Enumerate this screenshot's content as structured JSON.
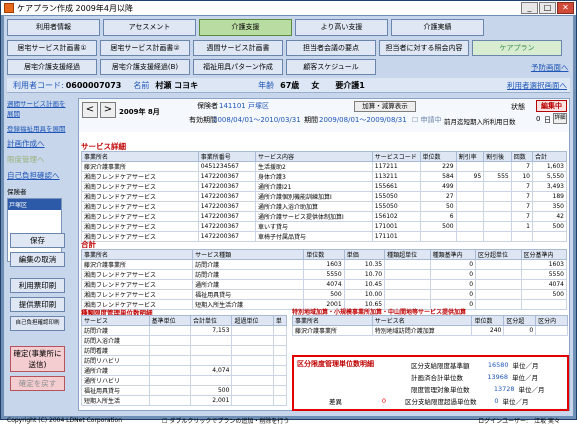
{
  "window": {
    "title": "ケアプラン作成 2009年4月以降",
    "minimize": "_",
    "maximize": "□",
    "close": "✕"
  },
  "tabs_row1": [
    "利用者情報",
    "アセスメント",
    "介護支援",
    "より高い支援",
    "介護実績"
  ],
  "tabs_row2": [
    "居宅サービス計画書①",
    "居宅サービス計画書②",
    "週間サービス計画書",
    "担当者会議の要点",
    "担当者に対する照会内容",
    "ケアプラン"
  ],
  "tabs_row3": [
    "居宅介護支援経過",
    "居宅介護支援経過(B)",
    "福祉用具パターン作成",
    "顧客スケジュール"
  ],
  "links": {
    "yobo": "予防画面へ",
    "user_select": "利用者選択画面へ"
  },
  "info": {
    "user_code_label": "利用者コード:",
    "user_code": "0600007073",
    "name_label": "名前",
    "name": "村瀬 コヨキ",
    "age_label": "年齢",
    "age": "67歳",
    "sex": "女",
    "care_level": "要介護1"
  },
  "left_nav": {
    "link1": "週間サービス計画を展開",
    "link2": "登録福祉用具を展開",
    "link3": "計画作成へ",
    "link4": "限度管理へ",
    "link5": "自己負担確認へ",
    "insurer_label": "保険者",
    "insurer_selected": "戸塚区",
    "buttons": [
      "保存",
      "編集の取消",
      "利用票印刷",
      "提供票印刷",
      "自己負担確認印刷"
    ],
    "confirm_button": "確定(事業所に送信)",
    "revert_button": "確定を戻す"
  },
  "plan": {
    "prev_arrow": "<",
    "next_arrow": ">",
    "year_month": "2009年 8月",
    "insurer_no_label": "保険者",
    "insurer_no": "141101 戸塚区",
    "valid_label": "有効期間",
    "valid": "2008/04/01〜2010/03/31",
    "period_label": "期間",
    "period": "2009/08/01〜2009/08/31",
    "add_btn": "加算・減算表示",
    "apply_label": "申請中",
    "prev_label": "前月迄短期入所利用日数",
    "prev_days": "0",
    "prev_unit": "日",
    "detail_btn": "詳細",
    "status_label": "状態",
    "status_btn": "編集中"
  },
  "service_detail": {
    "title": "サービス詳細",
    "headers": [
      "事業所名",
      "事業所番号",
      "サービス内容",
      "サービスコード",
      "単位数",
      "割引率",
      "割引後",
      "回数",
      "合計"
    ],
    "rows": [
      [
        "藤沢介護事業所",
        "0451234567",
        "生活援助2",
        "117211",
        "229",
        "",
        "",
        "7",
        "1,603"
      ],
      [
        "湘南フレンドケアサービス",
        "1472200367",
        "身体介護3",
        "113211",
        "584",
        "95",
        "555",
        "10",
        "5,550"
      ],
      [
        "湘南フレンドケアサービス",
        "1472200367",
        "通所介護I21",
        "155661",
        "499",
        "",
        "",
        "7",
        "3,493"
      ],
      [
        "湘南フレンドケアサービス",
        "1472200367",
        "通所介護個別機能訓練加算I",
        "155050",
        "27",
        "",
        "",
        "7",
        "189"
      ],
      [
        "湘南フレンドケアサービス",
        "1472200367",
        "通所介護入浴介助加算",
        "155050",
        "50",
        "",
        "",
        "7",
        "350"
      ],
      [
        "湘南フレンドケアサービス",
        "1472200367",
        "通所介護サービス提供体制加算I",
        "156102",
        "6",
        "",
        "",
        "7",
        "42"
      ],
      [
        "湘南フレンドケアサービス",
        "1472200367",
        "車いす貸与",
        "171001",
        "500",
        "",
        "",
        "1",
        "500"
      ],
      [
        "湘南フレンドケアサービス",
        "1472200367",
        "車椅子付属品貸与",
        "171101",
        "",
        "",
        "",
        "",
        ""
      ]
    ]
  },
  "totals": {
    "title": "合計",
    "headers": [
      "事業所名",
      "サービス種類",
      "単位数",
      "単価",
      "種類超単位",
      "種類基準内",
      "区分超単位",
      "区分基準内"
    ],
    "rows": [
      [
        "藤沢介護事業所",
        "訪問介護",
        "1603",
        "10.35",
        "",
        "0",
        "",
        "1603"
      ],
      [
        "湘南フレンドケアサービス",
        "訪問介護",
        "5550",
        "10.70",
        "",
        "0",
        "",
        "5550"
      ],
      [
        "湘南フレンドケアサービス",
        "通所介護",
        "4074",
        "10.45",
        "",
        "0",
        "",
        "4074"
      ],
      [
        "湘南フレンドケアサービス",
        "福祉用具貸与",
        "500",
        "10.00",
        "",
        "0",
        "",
        "500"
      ],
      [
        "湘南フレンドケアサービス",
        "短期入所生活介護",
        "2001",
        "10.65",
        "",
        "0",
        "",
        ""
      ]
    ]
  },
  "kind_limit": {
    "title": "種類限度管理単位数明細",
    "headers": [
      "サービス",
      "基準単位",
      "合計単位",
      "超過単位",
      "単"
    ],
    "rows": [
      [
        "訪問介護",
        "",
        "7,153",
        "",
        ""
      ],
      [
        "訪問入浴介護",
        "",
        "",
        "",
        ""
      ],
      [
        "訪問看護",
        "",
        "",
        "",
        ""
      ],
      [
        "訪問リハビリ",
        "",
        "",
        "",
        ""
      ],
      [
        "通所介護",
        "",
        "4,074",
        "",
        ""
      ],
      [
        "通所リハビリ",
        "",
        "",
        "",
        ""
      ],
      [
        "福祉用具貸与",
        "",
        "500",
        "",
        ""
      ],
      [
        "短期入所生活",
        "",
        "2,001",
        "",
        ""
      ]
    ]
  },
  "special": {
    "title": "特別地域加算・小規模事業所加算・中山間地等サービス提供加算",
    "headers": [
      "事業所名",
      "サービス名",
      "単位数",
      "区分超",
      "区分内"
    ],
    "rows": [
      [
        "藤沢介護事業所",
        "特別地域訪問介護加算",
        "240",
        "0",
        ""
      ]
    ]
  },
  "limit_box": {
    "title": "区分限度管理単位数明細",
    "base_label": "区分支給限度基準額",
    "base_value": "16580",
    "base_unit": "単位／月",
    "plan_label": "計画済合計単位数",
    "plan_value": "13968",
    "plan_unit": "単位／月",
    "managed_label": "限度管理対象単位数",
    "managed_value": "13728",
    "managed_unit": "単位／月",
    "diff_label": "差異",
    "diff_value": "0",
    "over_label": "区分支給限度超過単位数",
    "over_value": "0",
    "over_unit": "単位／月"
  },
  "bottom": {
    "copyright": "Copyright (C) 2004 LDNet Corporation",
    "checkbox_label": "ダブルクリックでプランの追加・削除を行う",
    "login_label": "ログインユーザー:",
    "login_user": "江坂 実々"
  },
  "colors": {
    "accent_red": "#e20000",
    "link_blue": "#1f56b8",
    "panel": "#c7d6ea"
  }
}
